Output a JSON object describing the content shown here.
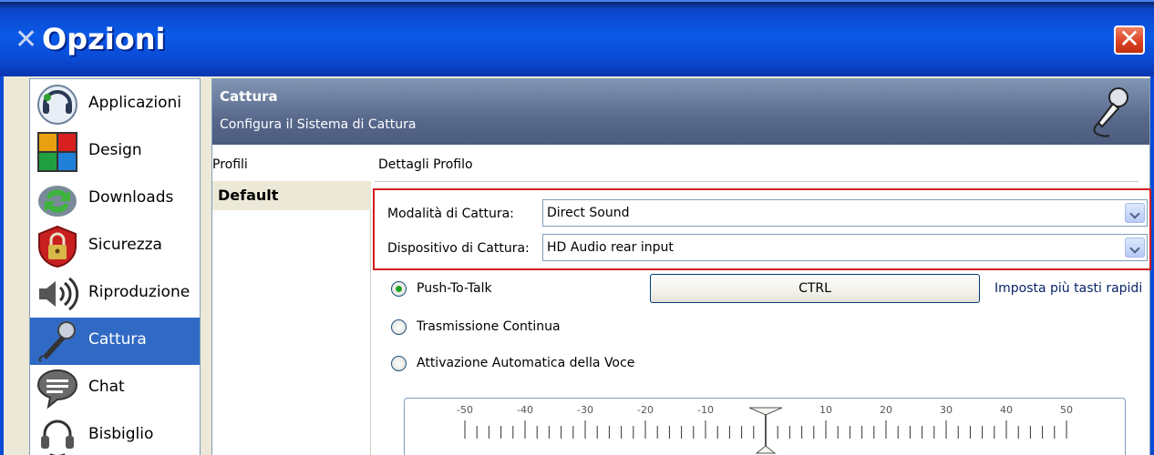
{
  "window": {
    "title": "Opzioni",
    "close_glyph": "✕",
    "colors": {
      "titlebar": "#0a4bd6",
      "selection": "#316ac5",
      "highlight_box": "#d21e1e",
      "header": "#58698c"
    }
  },
  "sidebar": {
    "items": [
      {
        "label": "Applicazioni",
        "icon": "teamspeak-logo-icon",
        "active": false
      },
      {
        "label": "Design",
        "icon": "color-tiles-icon",
        "active": false
      },
      {
        "label": "Downloads",
        "icon": "download-arrows-icon",
        "active": false
      },
      {
        "label": "Sicurezza",
        "icon": "padlock-shield-icon",
        "active": false
      },
      {
        "label": "Riproduzione",
        "icon": "speaker-icon",
        "active": false
      },
      {
        "label": "Cattura",
        "icon": "microphone-icon",
        "active": true
      },
      {
        "label": "Chat",
        "icon": "chat-bubble-icon",
        "active": false
      },
      {
        "label": "Bisbiglio",
        "icon": "headset-icon",
        "active": false
      }
    ]
  },
  "header": {
    "title": "Cattura",
    "subtitle": "Configura il Sistema di Cattura",
    "icon": "microphone-icon"
  },
  "profiles": {
    "label": "Profili",
    "items": [
      "Default"
    ],
    "selected": "Default"
  },
  "details": {
    "label": "Dettagli Profilo",
    "capture_mode": {
      "label": "Modalità di Cattura:",
      "value": "Direct Sound"
    },
    "capture_device": {
      "label": "Dispositivo di Cattura:",
      "value": "HD Audio rear input"
    },
    "modes": [
      {
        "label": "Push-To-Talk",
        "checked": true
      },
      {
        "label": "Trasmissione Continua",
        "checked": false
      },
      {
        "label": "Attivazione Automatica della Voce",
        "checked": false
      }
    ],
    "hotkey_button": "CTRL",
    "hotkeys_link": "Imposta più tasti rapidi",
    "meter": {
      "tick_labels": [
        "-50",
        "-40",
        "-30",
        "-20",
        "-10",
        "10",
        "20",
        "30",
        "40",
        "50"
      ],
      "value": 0
    }
  }
}
